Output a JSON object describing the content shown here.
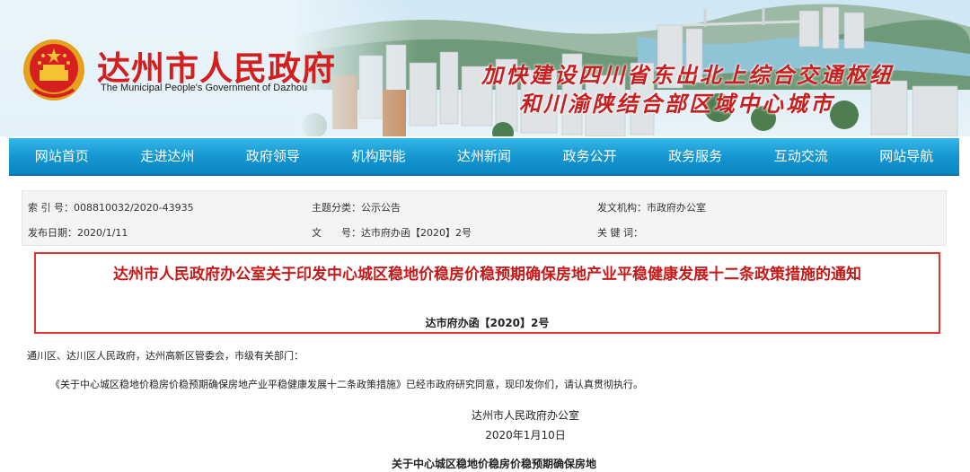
{
  "header": {
    "title": "达州市人民政府",
    "subtitle": "The Municipal People's Government of Dazhou",
    "slogan_line1": "加快建设四川省东出北上综合交通枢纽",
    "slogan_line2": "和川渝陕结合部区域中心城市",
    "emblem_icon": "national-emblem-icon"
  },
  "nav": {
    "items": [
      "网站首页",
      "走进达州",
      "政府领导",
      "机构职能",
      "达州新闻",
      "政务公开",
      "政务服务",
      "互动交流",
      "网站导航"
    ]
  },
  "meta": {
    "index_label": "索 引 号：",
    "index_value": "008810032/2020-43935",
    "category_label": "主题分类：",
    "category_value": "公示公告",
    "issuer_label": "发文机构：",
    "issuer_value": "市政府办公室",
    "date_label": "发布日期：",
    "date_value": "2020/1/11",
    "docno_label": "文　　号：",
    "docno_value": "达市府办函【2020】2号",
    "keywords_label": "关 键 词："
  },
  "document": {
    "title": "达州市人民政府办公室关于印发中心城区稳地价稳房价稳预期确保房地产业平稳健康发展十二条政策措施的通知",
    "number": "达市府办函【2020】2号",
    "recipients": "通川区、达川区人民政府，达州高新区管委会，市级有关部门：",
    "body": "《关于中心城区稳地价稳房价稳预期确保房地产业平稳健康发展十二条政策措施》已经市政府研究同意，现印发你们，请认真贯彻执行。",
    "signature": "达州市人民政府办公室",
    "sign_date": "2020年1月10日",
    "subheading": "关于中心城区稳地价稳房价稳预期确保房地"
  },
  "colors": {
    "brand_red": "#d41f1f",
    "nav_blue": "#1495cf",
    "title_border": "#e3342f"
  }
}
